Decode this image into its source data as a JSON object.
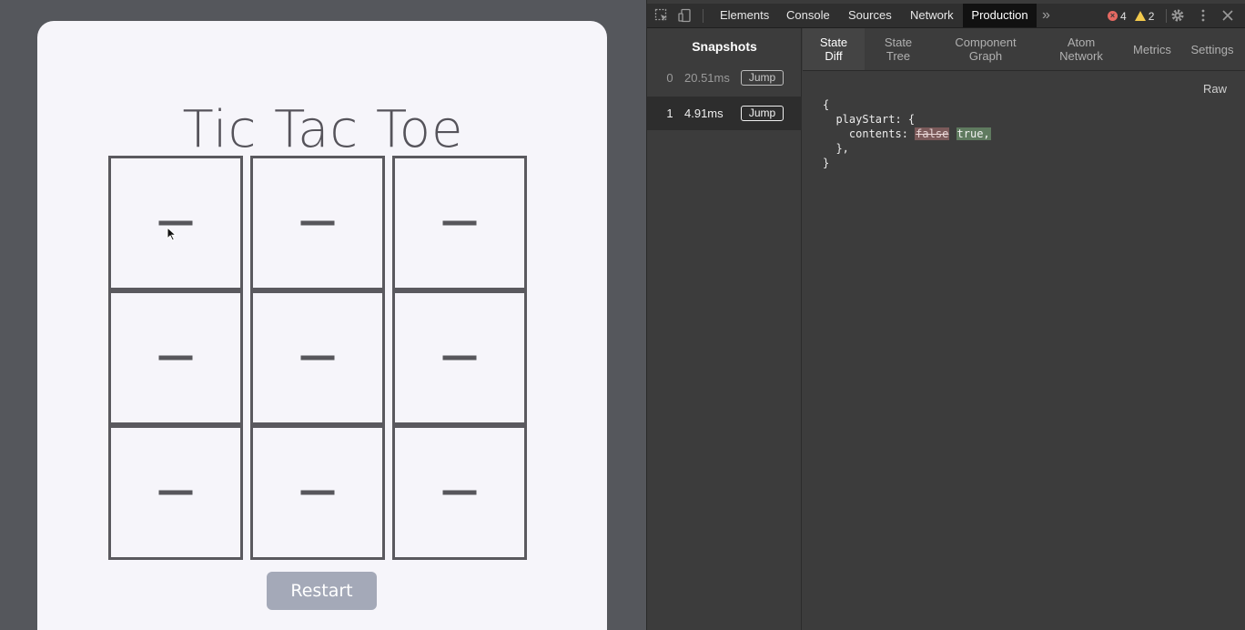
{
  "game": {
    "title": "Tic Tac Toe",
    "cells": [
      "",
      "",
      "",
      "",
      "",
      "",
      "",
      "",
      ""
    ],
    "restart_label": "Restart"
  },
  "devtools": {
    "toolbar": {
      "tabs": [
        "Elements",
        "Console",
        "Sources",
        "Network",
        "Production"
      ],
      "active_tab": "Production",
      "error_count": "4",
      "warning_count": "2"
    },
    "snapshots": {
      "title": "Snapshots",
      "rows": [
        {
          "index": "0",
          "time": "20.51ms",
          "jump_label": "Jump"
        },
        {
          "index": "1",
          "time": "4.91ms",
          "jump_label": "Jump"
        }
      ],
      "selected_index": 1
    },
    "diff_tabs": [
      {
        "line1": "State",
        "line2": "Diff"
      },
      {
        "line1": "State",
        "line2": "Tree"
      },
      {
        "line1": "Component",
        "line2": "Graph"
      },
      {
        "line1": "Atom",
        "line2": "Network"
      },
      {
        "line1": "Metrics",
        "line2": ""
      },
      {
        "line1": "Settings",
        "line2": ""
      }
    ],
    "raw_label": "Raw",
    "diff": {
      "open_brace": "{",
      "key": "playStart: {",
      "field": "contents:",
      "old_value": "false",
      "new_value": "true,",
      "close_inner": "},",
      "close_brace": "}"
    }
  },
  "colors": {
    "card_bg": "#f6f5fa",
    "restart_bg": "#a4a9b8",
    "active_tab_bg": "#111111",
    "diff_removed": "#7b5a5a",
    "diff_added": "#5f7a5f"
  }
}
